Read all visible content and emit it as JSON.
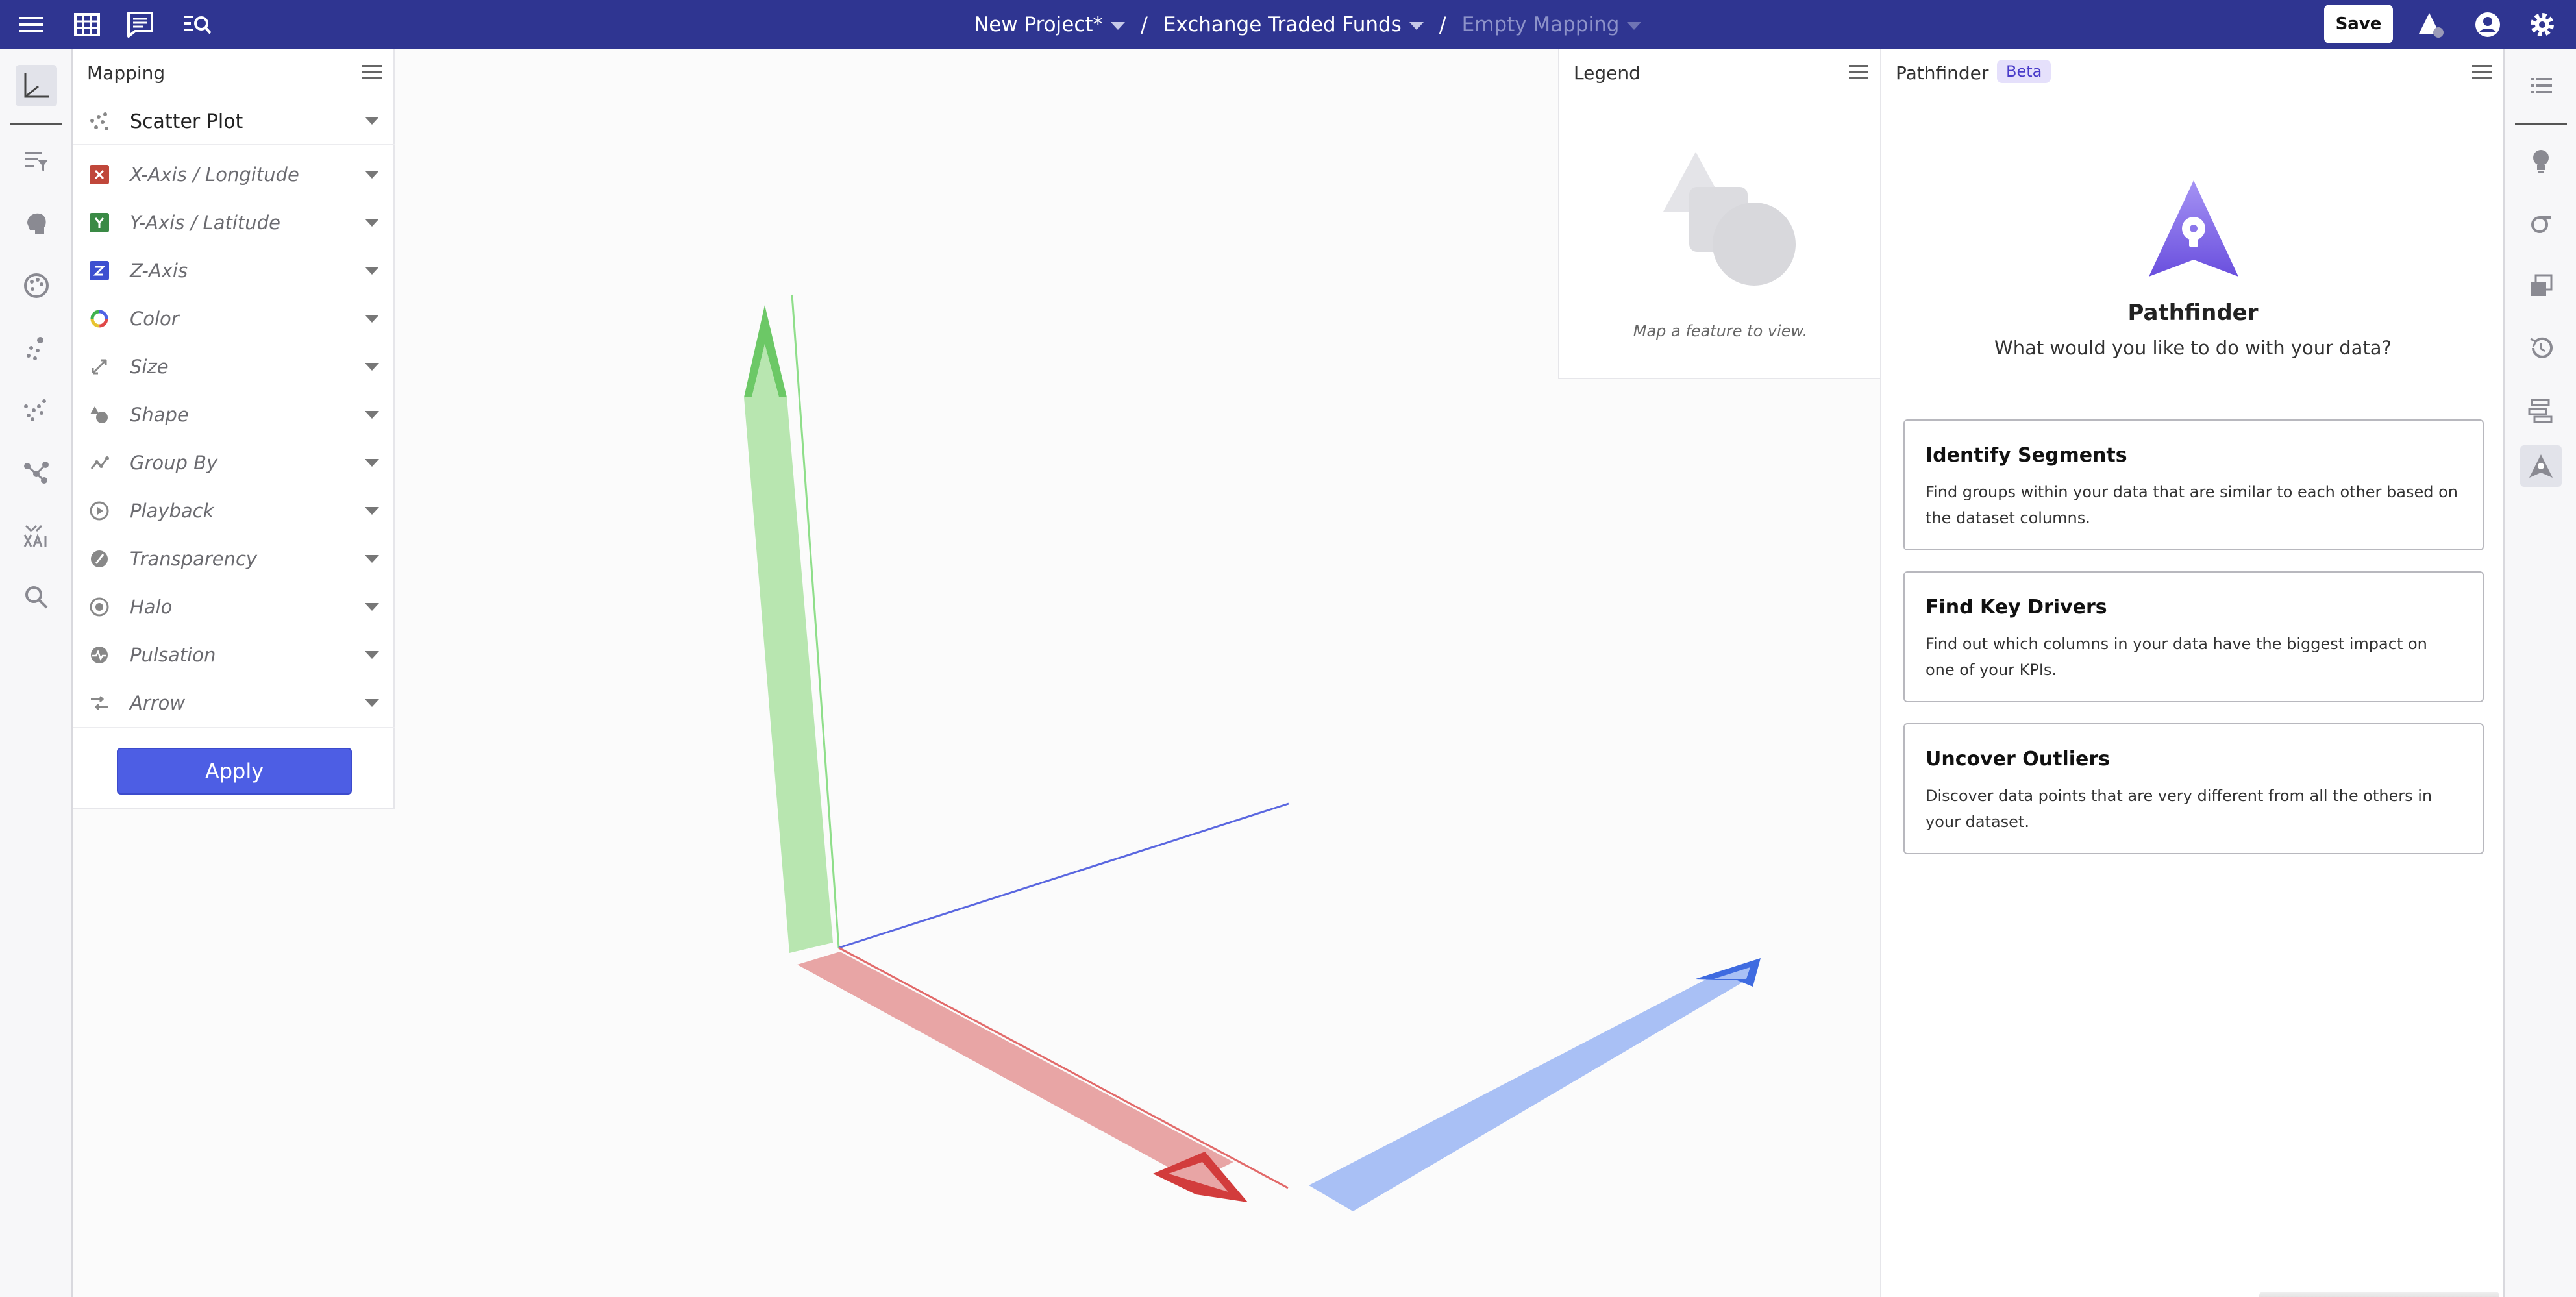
{
  "header": {
    "breadcrumbs": [
      {
        "label": "New Project*"
      },
      {
        "label": "Exchange Traded Funds"
      },
      {
        "label": "Empty Mapping"
      }
    ],
    "separator": "/",
    "save_label": "Save"
  },
  "mapping": {
    "title": "Mapping",
    "plot_type": "Scatter Plot",
    "rows": [
      {
        "label": "X-Axis / Longitude",
        "icon": "x-axis-icon"
      },
      {
        "label": "Y-Axis / Latitude",
        "icon": "y-axis-icon"
      },
      {
        "label": "Z-Axis",
        "icon": "z-axis-icon"
      },
      {
        "label": "Color",
        "icon": "color-wheel-icon"
      },
      {
        "label": "Size",
        "icon": "size-icon"
      },
      {
        "label": "Shape",
        "icon": "shape-icon"
      },
      {
        "label": "Group By",
        "icon": "group-by-icon"
      },
      {
        "label": "Playback",
        "icon": "play-icon"
      },
      {
        "label": "Transparency",
        "icon": "transparency-icon"
      },
      {
        "label": "Halo",
        "icon": "halo-icon"
      },
      {
        "label": "Pulsation",
        "icon": "pulsation-icon"
      },
      {
        "label": "Arrow",
        "icon": "arrow-icon"
      }
    ],
    "apply_label": "Apply"
  },
  "legend": {
    "title": "Legend",
    "empty_text": "Map a feature to view."
  },
  "pathfinder": {
    "title": "Pathfinder",
    "badge": "Beta",
    "heading": "Pathfinder",
    "subtitle": "What would you like to do with your data?",
    "cards": [
      {
        "title": "Identify Segments",
        "description": "Find groups within your data that are similar to each other based on the dataset columns."
      },
      {
        "title": "Find Key Drivers",
        "description": "Find out which columns in your data have the biggest impact on one of your KPIs."
      },
      {
        "title": "Uncover Outliers",
        "description": "Discover data points that are very different from all the others in your dataset."
      }
    ]
  },
  "colors": {
    "topbar": "#2f3591",
    "accent": "#4d5ee4",
    "axis_x": "#e8a5a5",
    "axis_y": "#b8e6b0",
    "axis_z": "#a9c0f5"
  }
}
